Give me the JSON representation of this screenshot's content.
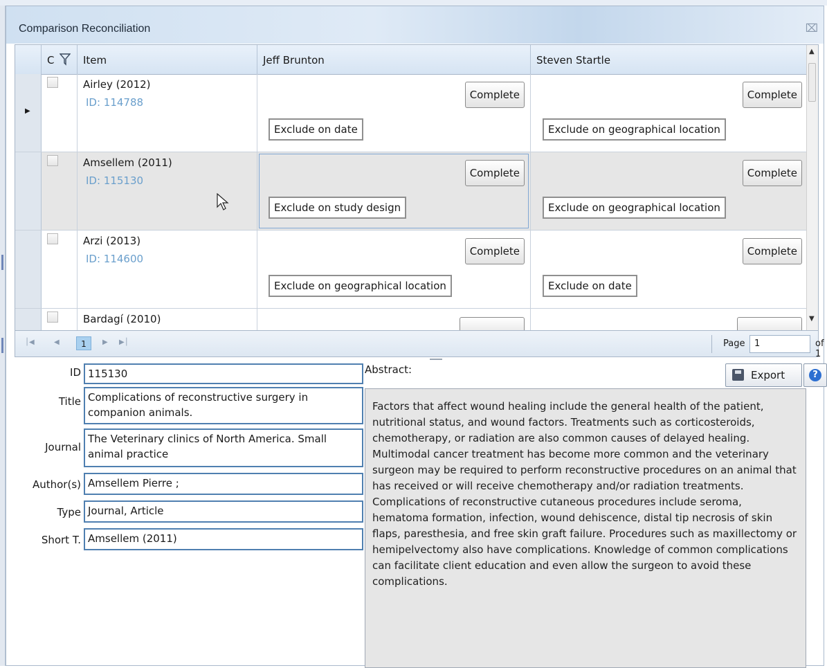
{
  "window": {
    "title": "Comparison Reconciliation"
  },
  "grid": {
    "columns": {
      "c": "C",
      "item": "Item",
      "reviewer1": "Jeff Brunton",
      "reviewer2": "Steven Startle"
    },
    "rows": [
      {
        "name": "Airley (2012)",
        "id": "ID: 114788",
        "r1_button": "Complete",
        "r1_decision": "Exclude on date",
        "r2_button": "Complete",
        "r2_decision": "Exclude on geographical location"
      },
      {
        "name": "Amsellem (2011)",
        "id": "ID: 115130",
        "r1_button": "Complete",
        "r1_decision": "Exclude on study design",
        "r2_button": "Complete",
        "r2_decision": "Exclude on geographical location"
      },
      {
        "name": "Arzi (2013)",
        "id": "ID: 114600",
        "r1_button": "Complete",
        "r1_decision": "Exclude on geographical location",
        "r2_button": "Complete",
        "r2_decision": "Exclude on date"
      },
      {
        "name": "Bardagí (2010)"
      }
    ]
  },
  "pager": {
    "current": "1",
    "page_label": "Page",
    "page_value": "1",
    "of_label": "of 1"
  },
  "details": {
    "id_label": "ID",
    "id_value": "115130",
    "title_label": "Title",
    "title_value": "Complications of reconstructive surgery in companion animals.",
    "journal_label": "Journal",
    "journal_value": "The Veterinary clinics of North America. Small animal practice",
    "authors_label": "Author(s)",
    "authors_value": "Amsellem Pierre ;",
    "type_label": "Type",
    "type_value": "Journal, Article",
    "short_label": "Short T.",
    "short_value": "Amsellem (2011)"
  },
  "abstract": {
    "label": "Abstract:",
    "text": "Factors that affect wound healing include the general health of the patient, nutritional status, and wound factors. Treatments such as corticosteroids, chemotherapy, or radiation are also common causes of delayed healing. Multimodal cancer treatment has become more common and the veterinary surgeon may be required to perform reconstructive procedures on an animal that has received or will receive chemotherapy and/or radiation treatments. Complications of reconstructive cutaneous procedures include seroma, hematoma formation, infection, wound dehiscence, distal tip necrosis of skin flaps, paresthesia, and free skin graft failure. Procedures such as maxillectomy or hemipelvectomy also have complications. Knowledge of common complications can facilitate client education and even allow the surgeon to avoid these complications."
  },
  "toolbar": {
    "export_label": "Export",
    "help_symbol": "?"
  }
}
